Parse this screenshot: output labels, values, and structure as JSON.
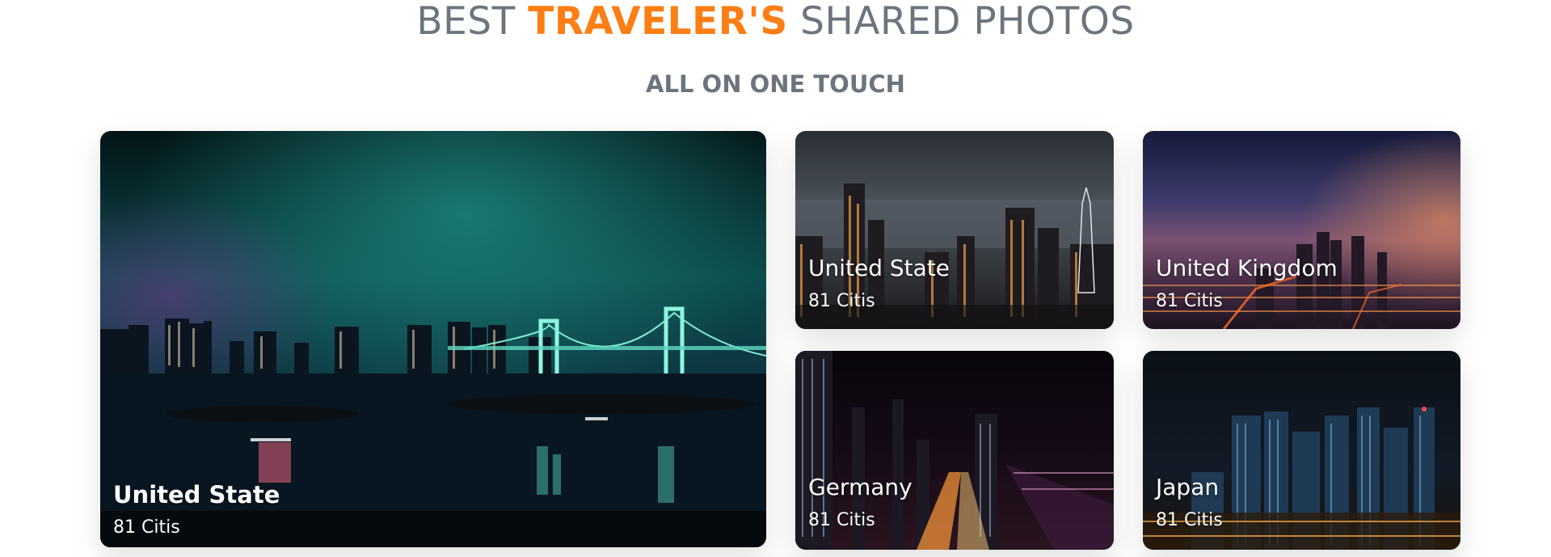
{
  "heading": {
    "prefix": "BEST",
    "accent": "TRAVELER'S",
    "suffix": "SHARED PHOTOS",
    "accent_color": "#fd7e14",
    "text_color": "#6c757d"
  },
  "subheading": "ALL ON ONE TOUCH",
  "cards": [
    {
      "title": "United State",
      "count": "81 Citis"
    },
    {
      "title": "United State",
      "count": "81 Citis"
    },
    {
      "title": "United Kingdom",
      "count": "81 Citis"
    },
    {
      "title": "Germany",
      "count": "81 Citis"
    },
    {
      "title": "Japan",
      "count": "81 Citis"
    }
  ]
}
